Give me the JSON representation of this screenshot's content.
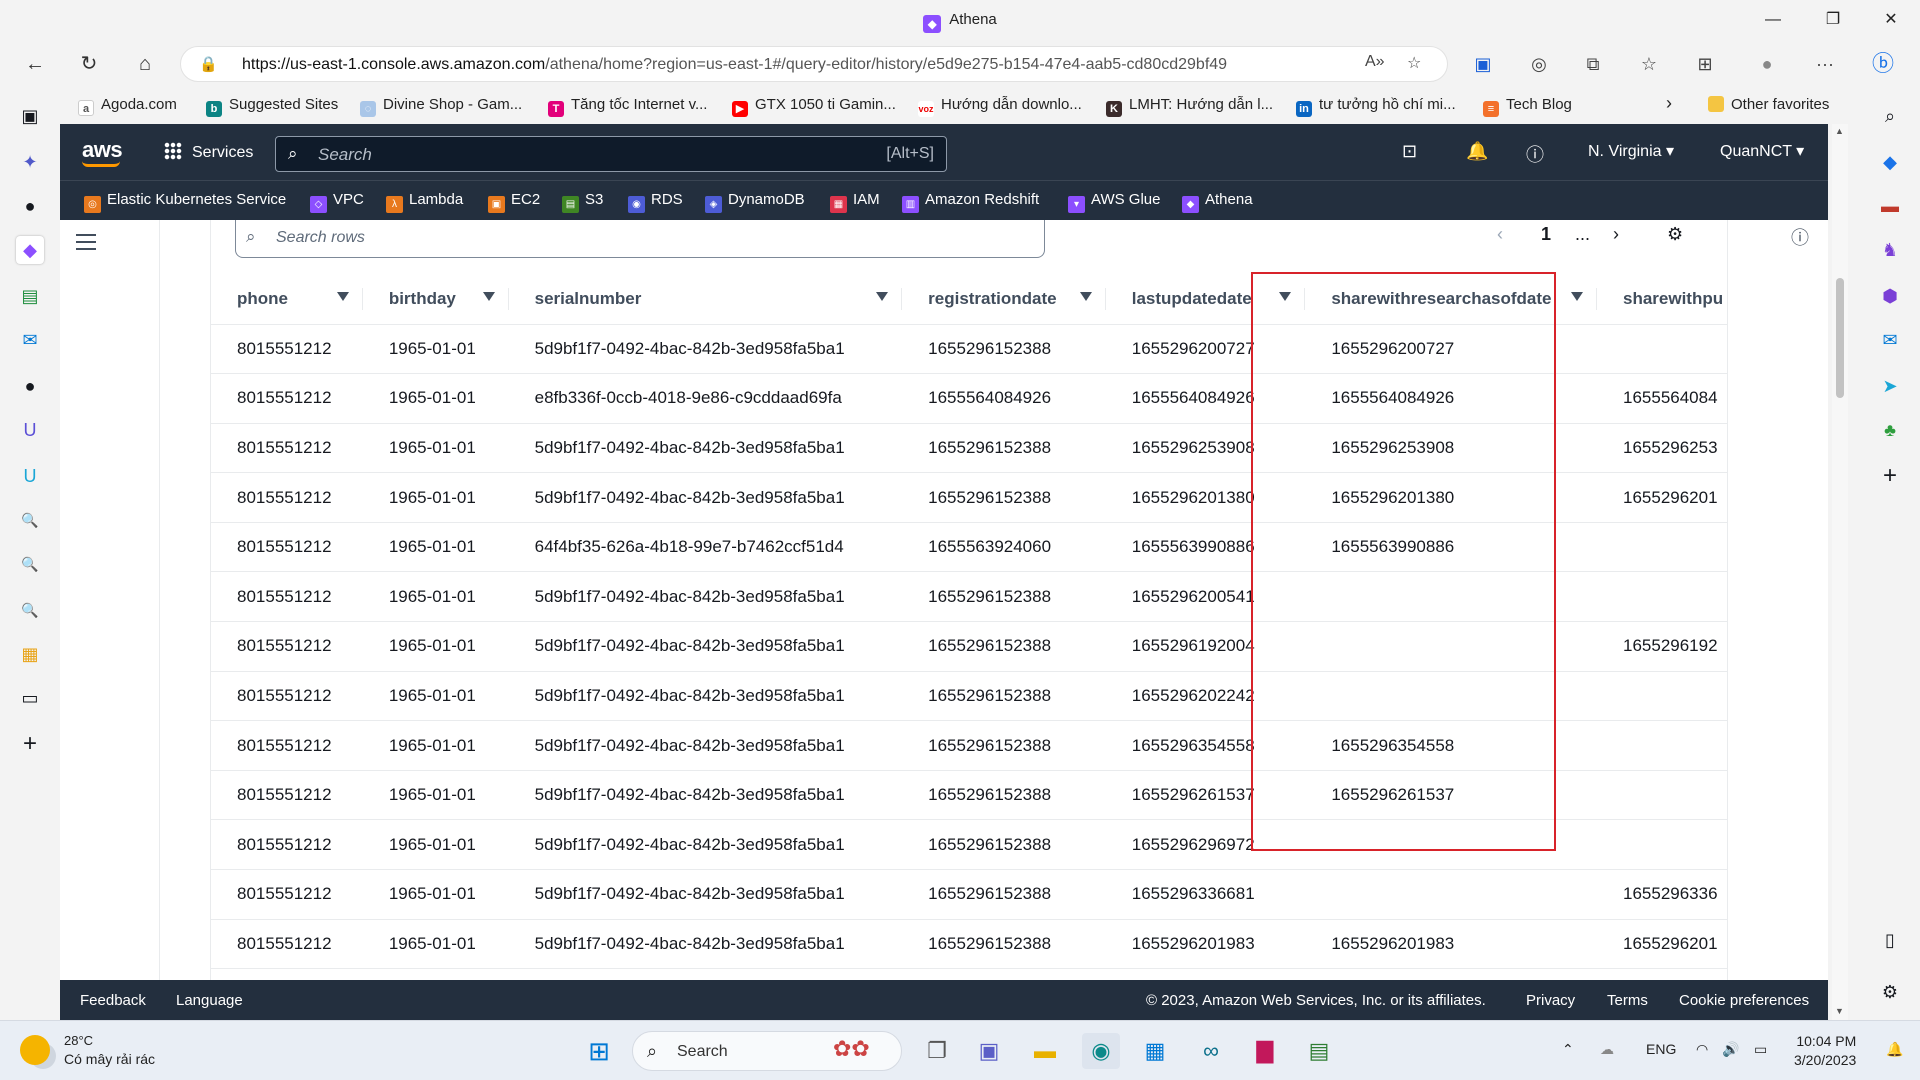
{
  "window": {
    "title": "Athena",
    "minimize": "—",
    "restore": "❐",
    "close": "✕"
  },
  "address": {
    "url_host": "https://us-east-1.console.aws.amazon.com",
    "url_path": "/athena/home?region=us-east-1#/query-editor/history/e5d9e275-b154-47e4-aab5-cd80cd29bf49"
  },
  "favorites": [
    "Agoda.com",
    "Suggested Sites",
    "Divine Shop - Gam...",
    "Tăng tốc Internet v...",
    "GTX 1050 ti Gamin...",
    "Hướng dẫn downlo...",
    "LMHT: Hướng dẫn l...",
    "tư tưởng hồ chí mi...",
    "Tech Blog"
  ],
  "favorites_other": "Other favorites",
  "aws": {
    "logo": "aws",
    "services": "Services",
    "search_placeholder": "Search",
    "search_shortcut": "[Alt+S]",
    "region": "N. Virginia",
    "user": "QuanNCT",
    "service_shortcuts": [
      "Elastic Kubernetes Service",
      "VPC",
      "Lambda",
      "EC2",
      "S3",
      "RDS",
      "DynamoDB",
      "IAM",
      "Amazon Redshift",
      "AWS Glue",
      "Athena"
    ]
  },
  "results": {
    "search_placeholder": "Search rows",
    "page": "1",
    "page_more": "...",
    "columns": [
      "phone",
      "birthday",
      "serialnumber",
      "registrationdate",
      "lastupdatedate",
      "sharewithresearchasofdate",
      "sharewithpu"
    ],
    "rows": [
      [
        "8015551212",
        "1965-01-01",
        "5d9bf1f7-0492-4bac-842b-3ed958fa5ba1",
        "1655296152388",
        "1655296200727",
        "1655296200727",
        ""
      ],
      [
        "8015551212",
        "1965-01-01",
        "e8fb336f-0ccb-4018-9e86-c9cddaad69fa",
        "1655564084926",
        "1655564084926",
        "1655564084926",
        "1655564084"
      ],
      [
        "8015551212",
        "1965-01-01",
        "5d9bf1f7-0492-4bac-842b-3ed958fa5ba1",
        "1655296152388",
        "1655296253908",
        "1655296253908",
        "1655296253"
      ],
      [
        "8015551212",
        "1965-01-01",
        "5d9bf1f7-0492-4bac-842b-3ed958fa5ba1",
        "1655296152388",
        "1655296201380",
        "1655296201380",
        "1655296201"
      ],
      [
        "8015551212",
        "1965-01-01",
        "64f4bf35-626a-4b18-99e7-b7462ccf51d4",
        "1655563924060",
        "1655563990886",
        "1655563990886",
        ""
      ],
      [
        "8015551212",
        "1965-01-01",
        "5d9bf1f7-0492-4bac-842b-3ed958fa5ba1",
        "1655296152388",
        "1655296200541",
        "",
        ""
      ],
      [
        "8015551212",
        "1965-01-01",
        "5d9bf1f7-0492-4bac-842b-3ed958fa5ba1",
        "1655296152388",
        "1655296192004",
        "",
        "1655296192"
      ],
      [
        "8015551212",
        "1965-01-01",
        "5d9bf1f7-0492-4bac-842b-3ed958fa5ba1",
        "1655296152388",
        "1655296202242",
        "",
        ""
      ],
      [
        "8015551212",
        "1965-01-01",
        "5d9bf1f7-0492-4bac-842b-3ed958fa5ba1",
        "1655296152388",
        "1655296354558",
        "1655296354558",
        ""
      ],
      [
        "8015551212",
        "1965-01-01",
        "5d9bf1f7-0492-4bac-842b-3ed958fa5ba1",
        "1655296152388",
        "1655296261537",
        "1655296261537",
        ""
      ],
      [
        "8015551212",
        "1965-01-01",
        "5d9bf1f7-0492-4bac-842b-3ed958fa5ba1",
        "1655296152388",
        "1655296296972",
        "",
        ""
      ],
      [
        "8015551212",
        "1965-01-01",
        "5d9bf1f7-0492-4bac-842b-3ed958fa5ba1",
        "1655296152388",
        "1655296336681",
        "",
        "1655296336"
      ],
      [
        "8015551212",
        "1965-01-01",
        "5d9bf1f7-0492-4bac-842b-3ed958fa5ba1",
        "1655296152388",
        "1655296201983",
        "1655296201983",
        "1655296201"
      ]
    ]
  },
  "footer": {
    "feedback": "Feedback",
    "language": "Language",
    "copyright": "© 2023, Amazon Web Services, Inc. or its affiliates.",
    "privacy": "Privacy",
    "terms": "Terms",
    "cookies": "Cookie preferences"
  },
  "taskbar": {
    "temp": "28°C",
    "weather": "Có mây rải rác",
    "search": "Search",
    "lang": "ENG",
    "time": "10:04 PM",
    "date": "3/20/2023"
  },
  "colors": {
    "aws_nav": "#232f3e",
    "highlight": "#d8232a",
    "aws_orange": "#ff9900"
  }
}
